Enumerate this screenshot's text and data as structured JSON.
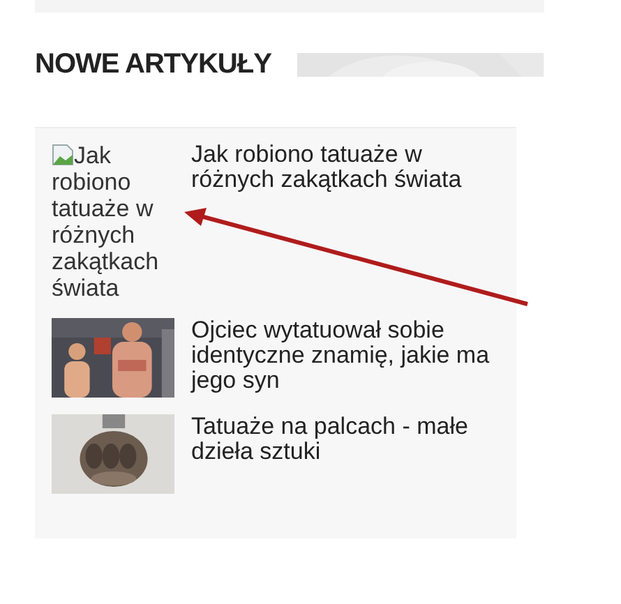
{
  "section": {
    "title": "NOWE ARTYKUŁY"
  },
  "articles": [
    {
      "kind": "broken",
      "alt": "Jak robiono tatuaże w różnych zakątkach świata",
      "title": "Jak robiono tatuaże w różnych zakątkach świata"
    },
    {
      "kind": "people",
      "title": "Ojciec wytatuował sobie identyczne znamię, jakie ma jego syn"
    },
    {
      "kind": "fist",
      "title": "Tatuaże na palcach - małe dzieła sztuki"
    }
  ],
  "annotation": {
    "kind": "arrow",
    "color": "#b01c1c"
  }
}
